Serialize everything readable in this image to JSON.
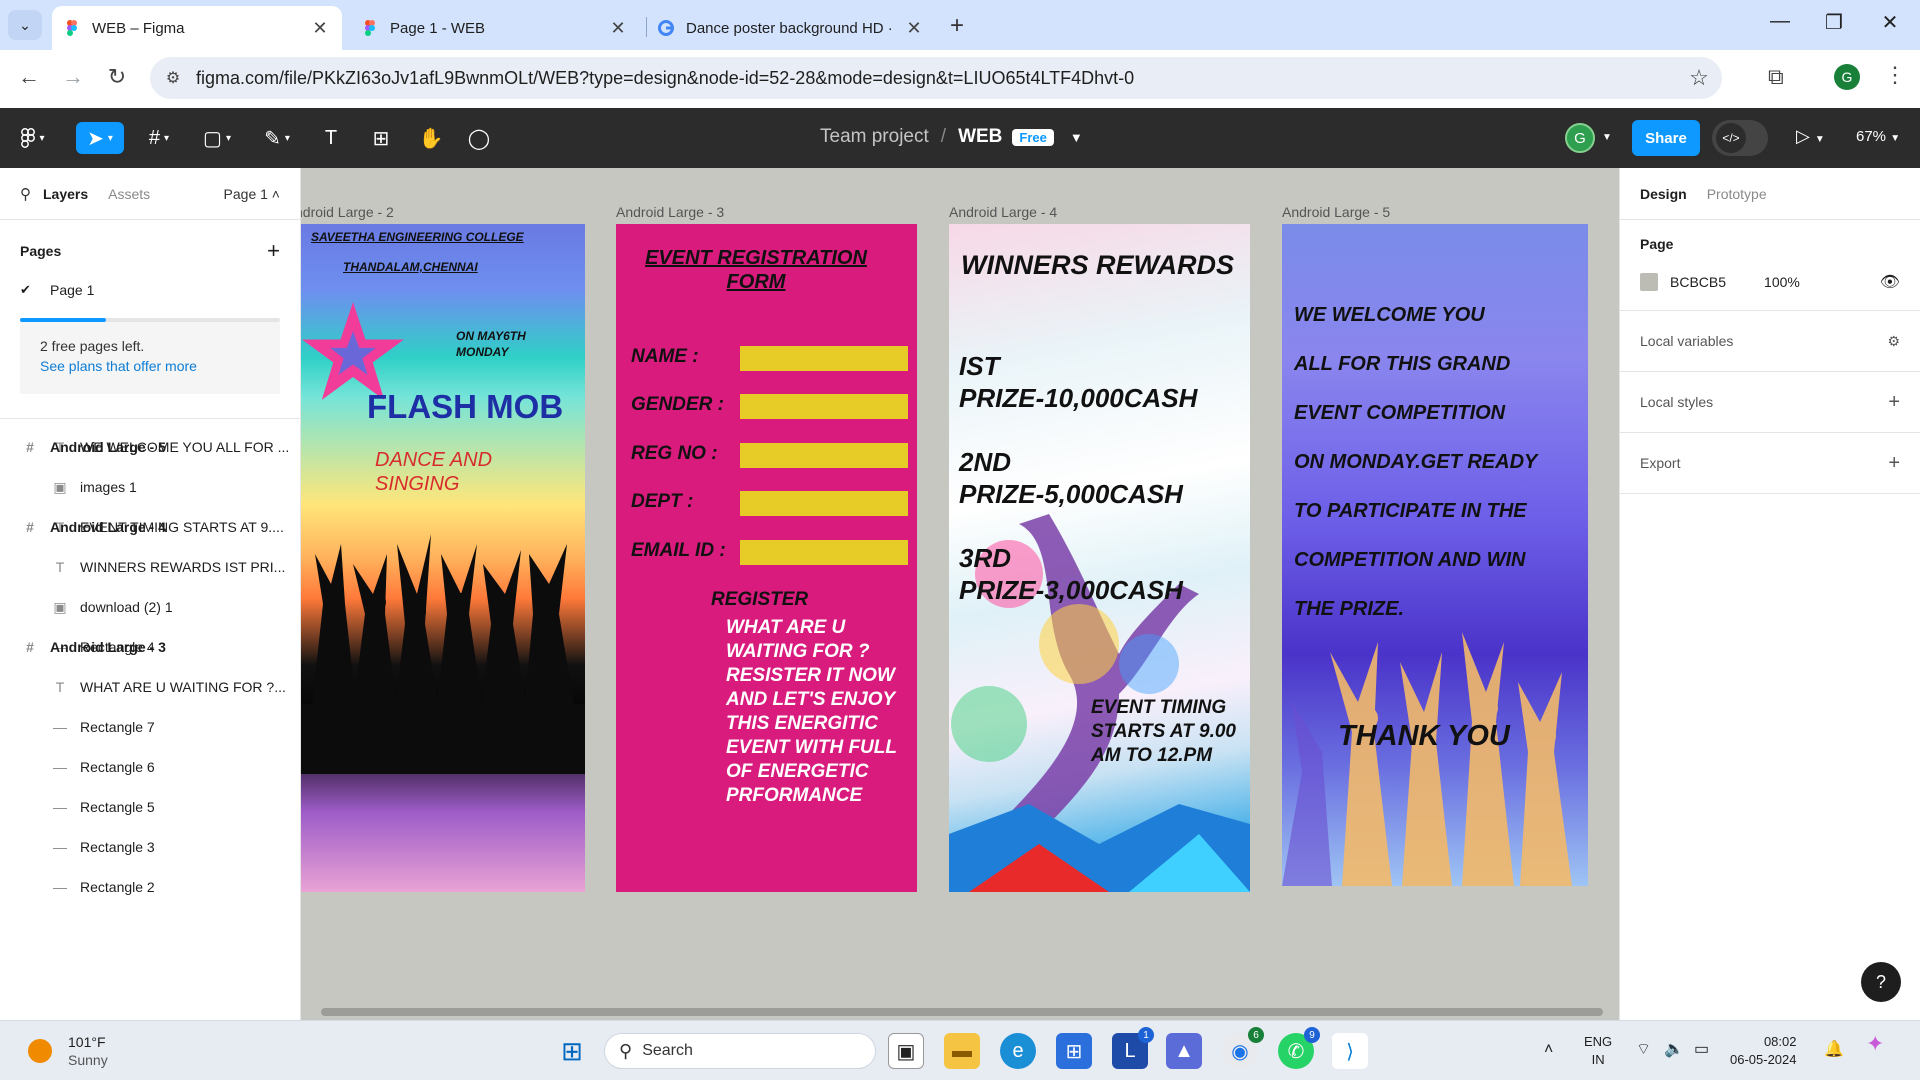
{
  "browser": {
    "tabs": [
      {
        "title": "WEB – Figma",
        "active": true
      },
      {
        "title": "Page 1 - WEB",
        "active": false
      },
      {
        "title": "Dance poster background HD ·",
        "active": false
      }
    ],
    "url": "figma.com/file/PKkZI63oJv1afL9BwnmOLt/WEB?type=design&node-id=52-28&mode=design&t=LIUO65t4LTF4Dhvt-0",
    "profile_initial": "G"
  },
  "figma": {
    "team": "Team project",
    "file": "WEB",
    "plan_badge": "Free",
    "user_initial": "G",
    "share_label": "Share",
    "zoom": "67%"
  },
  "left_panel": {
    "tab_layers": "Layers",
    "tab_assets": "Assets",
    "page_selector": "Page 1",
    "pages_heading": "Pages",
    "pages": [
      "Page 1"
    ],
    "free_pages_progress": 0.33,
    "free_pages_note": "2 free pages left.",
    "free_pages_link": "See plans that offer more",
    "layers": [
      {
        "kind": "frame",
        "icon": "#",
        "name": "Android Large - 5"
      },
      {
        "kind": "child",
        "icon": "T",
        "name": "WE WELCOME YOU ALL FOR ..."
      },
      {
        "kind": "child",
        "icon": "▣",
        "name": "images 1"
      },
      {
        "kind": "frame",
        "icon": "#",
        "name": "Android Large - 4"
      },
      {
        "kind": "child",
        "icon": "T",
        "name": "EVENT TIMING STARTS AT 9...."
      },
      {
        "kind": "child",
        "icon": "T",
        "name": "WINNERS REWARDS IST PRI..."
      },
      {
        "kind": "child",
        "icon": "▣",
        "name": "download (2) 1"
      },
      {
        "kind": "frame",
        "icon": "#",
        "name": "Android Large - 3"
      },
      {
        "kind": "child",
        "icon": "—",
        "name": "Rectangle 4"
      },
      {
        "kind": "child",
        "icon": "T",
        "name": "WHAT ARE U WAITING FOR ?..."
      },
      {
        "kind": "child",
        "icon": "—",
        "name": "Rectangle 7"
      },
      {
        "kind": "child",
        "icon": "—",
        "name": "Rectangle 6"
      },
      {
        "kind": "child",
        "icon": "—",
        "name": "Rectangle 5"
      },
      {
        "kind": "child",
        "icon": "—",
        "name": "Rectangle 3"
      },
      {
        "kind": "child",
        "icon": "—",
        "name": "Rectangle 2"
      }
    ]
  },
  "canvas": {
    "frame_labels": [
      "ndroid Large - 2",
      "Android Large - 3",
      "Android Large - 4",
      "Android Large - 5"
    ],
    "frame2": {
      "college": "SAVEETHA ENGINEERING COLLEGE",
      "city": "THANDALAM,CHENNAI",
      "date_line1": "ON MAY6TH",
      "date_line2": "MONDAY",
      "headline": "FLASH MOB",
      "sub_line1": "DANCE AND",
      "sub_line2": "SINGING"
    },
    "frame3": {
      "heading_line1": "EVENT REGISTRATION",
      "heading_line2": "FORM",
      "fields": [
        "NAME :",
        "GENDER :",
        "REG NO :",
        "DEPT :",
        "EMAIL ID :"
      ],
      "register": "REGISTER",
      "message": "WHAT ARE U WAITING FOR ? RESISTER IT NOW AND LET'S ENJOY THIS ENERGITIC EVENT WITH FULL OF ENERGETIC PRFORMANCE"
    },
    "frame4": {
      "title": "WINNERS REWARDS",
      "prizes": [
        {
          "line1": "IST",
          "line2": "PRIZE-10,000CASH"
        },
        {
          "line1": "2ND",
          "line2": "PRIZE-5,000CASH"
        },
        {
          "line1": "3RD",
          "line2": "PRIZE-3,000CASH"
        }
      ],
      "timing": "EVENT TIMING STARTS AT 9.00 AM TO 12.PM"
    },
    "frame5": {
      "lines": [
        "WE WELCOME YOU",
        "ALL FOR THIS GRAND",
        "EVENT COMPETITION",
        "ON  MONDAY.GET READY",
        " TO PARTICIPATE IN THE",
        " COMPETITION  AND WIN",
        "THE PRIZE."
      ],
      "thanks": "THANK YOU"
    }
  },
  "right_panel": {
    "tab_design": "Design",
    "tab_prototype": "Prototype",
    "page_heading": "Page",
    "page_color": "BCBCB5",
    "page_opacity": "100%",
    "sections": [
      "Local variables",
      "Local styles",
      "Export"
    ],
    "help": "?"
  },
  "taskbar": {
    "temp": "101°F",
    "condition": "Sunny",
    "search_placeholder": "Search",
    "lang1": "ENG",
    "lang2": "IN",
    "time": "08:02",
    "date": "06-05-2024",
    "badges": {
      "l_app": "1",
      "chrome": "6",
      "whatsapp": "9"
    }
  },
  "colors": {
    "figma_blue": "#0d99ff",
    "canvas_bg": "#c7c7c2",
    "poster_pink": "#d81b7c",
    "form_yellow": "#e7cc27"
  }
}
